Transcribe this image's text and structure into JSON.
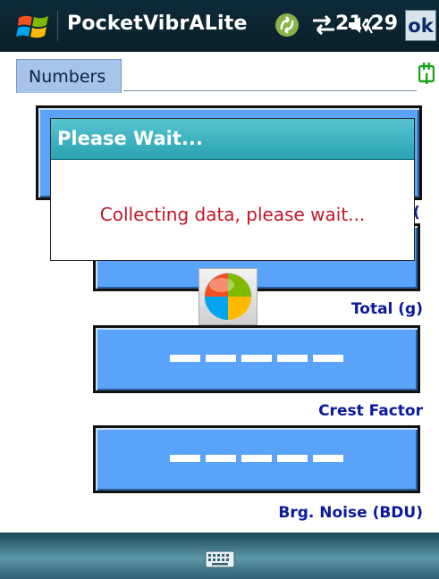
{
  "titlebar": {
    "app_title": "PocketVibrALite",
    "time": "21:29",
    "ok_label": "ok",
    "icons": [
      "windows-start-icon",
      "sync-icon",
      "connectivity-icon",
      "volume-icon"
    ]
  },
  "tabs": {
    "active_tab": "Numbers"
  },
  "readings": [
    {
      "caption": "(",
      "value": "--------"
    },
    {
      "caption": "Total (g)",
      "value": "--------"
    },
    {
      "caption": "Crest Factor",
      "value": "--------"
    },
    {
      "caption": "Brg. Noise (BDU)",
      "value": "--------"
    }
  ],
  "dialog": {
    "title": "Please Wait...",
    "message": "Collecting data, please wait..."
  },
  "colors": {
    "title_bg": "#0e2a3a",
    "value_box": "#5aa3fb",
    "caption": "#0a1a9a",
    "dialog_header": "#3bb3c0",
    "dialog_message": "#c2152a",
    "tab_bg": "#a8c3ea"
  },
  "bottombar": {
    "icons": [
      "keyboard-icon"
    ]
  }
}
